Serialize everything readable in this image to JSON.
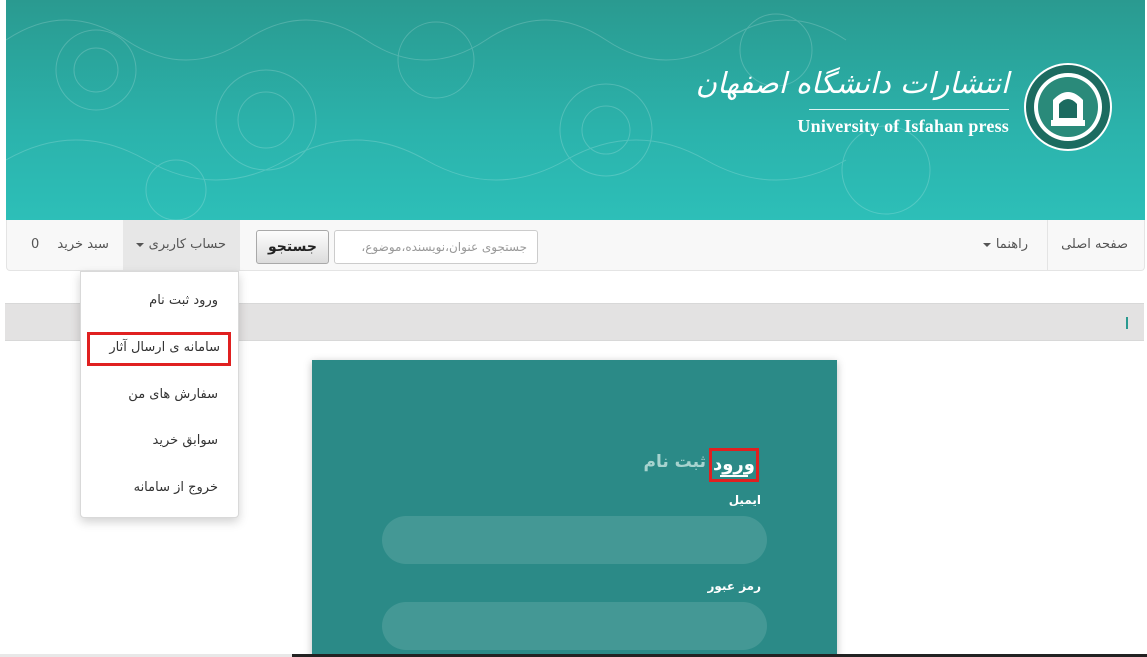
{
  "brand": {
    "name_fa": "انتشارات دانشگاه اصفهان",
    "name_en": "University of Isfahan press",
    "accent_color": "#2bb3ac"
  },
  "navbar": {
    "home": "صفحه اصلی",
    "help": "راهنما",
    "search_button": "جستجو",
    "search_placeholder": "جستجوی عنوان،نویسنده،موضوع،",
    "account": "حساب کاربری",
    "cart_label": "سبد خرید",
    "cart_count": "0"
  },
  "account_menu": {
    "items": [
      "ورود ثبت نام",
      "سامانه ی ارسال آثار",
      "سفارش های من",
      "سوابق خرید",
      "خروج از سامانه"
    ]
  },
  "login_card": {
    "tab_login": "ورود",
    "tab_register": "ثبت نام",
    "email_label": "ایمیل",
    "password_label": "رمز عبور"
  }
}
